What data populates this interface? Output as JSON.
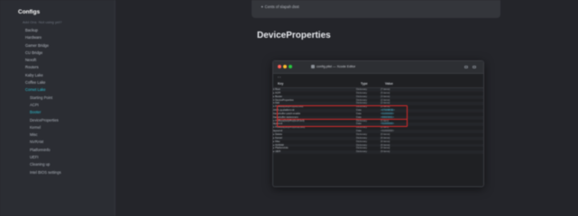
{
  "sidebar": {
    "title": "Configs",
    "subtitle": "Add Ons ·Not using yet?",
    "items": [
      {
        "label": "Backup",
        "child": false,
        "active": false
      },
      {
        "label": "Hardware",
        "child": false,
        "active": false
      },
      {
        "label": "Gamer Bridge",
        "child": false,
        "active": false
      },
      {
        "label": "CU Bridge",
        "child": false,
        "active": false
      },
      {
        "label": "Nexoft",
        "child": false,
        "active": false
      },
      {
        "label": "Routers",
        "child": false,
        "active": false
      },
      {
        "label": "Kaby Lake",
        "child": false,
        "active": false
      },
      {
        "label": "Coffee Lake",
        "child": false,
        "active": false
      },
      {
        "label": "Comet Lake",
        "child": false,
        "active": true
      },
      {
        "label": "Starting Point",
        "child": true,
        "active": false
      },
      {
        "label": "ACPI",
        "child": true,
        "active": false
      },
      {
        "label": "Booter",
        "child": true,
        "active": true
      },
      {
        "label": "DeviceProperties",
        "child": true,
        "active": false
      },
      {
        "label": "Kernel",
        "child": true,
        "active": false
      },
      {
        "label": "Misc",
        "child": true,
        "active": false
      },
      {
        "label": "NVRAM",
        "child": true,
        "active": false
      },
      {
        "label": "PlatformInfo",
        "child": true,
        "active": false
      },
      {
        "label": "UEFI",
        "child": true,
        "active": false
      },
      {
        "label": "Cleaning up",
        "child": true,
        "active": false
      },
      {
        "label": "Intel BIOS settings",
        "child": true,
        "active": false
      }
    ]
  },
  "callout": {
    "text": "✦ Cents of slapah dsst"
  },
  "main": {
    "heading": "DeviceProperties"
  },
  "screenshot": {
    "window_title": "config.plist — Xcode Editor",
    "toolbar": "‹  ›",
    "columns": {
      "key": "Key",
      "type": "Type",
      "value": "Value"
    },
    "rows": [
      {
        "key": "▾ Root",
        "type": "Dictionary",
        "value": "(7 items)",
        "hl": false
      },
      {
        "key": "  ▸ ACPI",
        "type": "Dictionary",
        "value": "(5 items)",
        "hl": false
      },
      {
        "key": "  ▸ Booter",
        "type": "Dictionary",
        "value": "(3 items)",
        "hl": false
      },
      {
        "key": "  ▾ DeviceProperties",
        "type": "Dictionary",
        "value": "(2 items)",
        "hl": false
      },
      {
        "key": "    ▾ Add",
        "type": "Dictionary",
        "value": "(2 items)",
        "hl": false
      },
      {
        "key": "      ▾ PciRoot(0x0)/Pci(0x2,0x0)",
        "type": "Dictionary",
        "value": "(3 items)",
        "hl": false
      },
      {
        "key": "          AAPL,ig-platform-id",
        "type": "Data",
        "value": "<07009B3E>",
        "hl": true
      },
      {
        "key": "          framebuffer-patch-enable",
        "type": "Data",
        "value": "<01000000>",
        "hl": true
      },
      {
        "key": "          framebuffer-stolenmem",
        "type": "Data",
        "value": "<00003001>",
        "hl": true
      },
      {
        "key": "      ▾ PciRoot(0x0)/Pci(0x1F,0x3)",
        "type": "Dictionary",
        "value": "(1 item)",
        "hl": false
      },
      {
        "key": "          layout-id",
        "type": "Data",
        "value": "<01000000>",
        "hl": true
      },
      {
        "key": "      ▾ PciRoot(0x0)/Pci(0x1B,0x0)",
        "type": "Dictionary",
        "value": "(1 item)",
        "hl": false
      },
      {
        "key": "          layout-id",
        "type": "Data",
        "value": "<01000000>",
        "hl": false
      },
      {
        "key": "    ▸ Delete",
        "type": "Dictionary",
        "value": "(0 items)",
        "hl": false
      },
      {
        "key": "  ▸ Kernel",
        "type": "Dictionary",
        "value": "(6 items)",
        "hl": false
      },
      {
        "key": "  ▸ Misc",
        "type": "Dictionary",
        "value": "(6 items)",
        "hl": false
      },
      {
        "key": "  ▸ NVRAM",
        "type": "Dictionary",
        "value": "(6 items)",
        "hl": false
      },
      {
        "key": "  ▸ PlatformInfo",
        "type": "Dictionary",
        "value": "(4 items)",
        "hl": false
      },
      {
        "key": "  ▸ UEFI",
        "type": "Dictionary",
        "value": "(9 items)",
        "hl": false
      }
    ],
    "highlight_color": "#d82a2a"
  }
}
